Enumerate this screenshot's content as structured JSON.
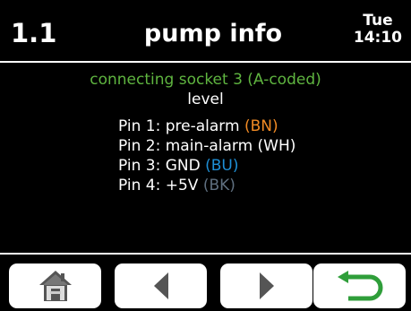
{
  "header": {
    "menu_number": "1.1",
    "title": "pump info",
    "day": "Tue",
    "time": "14:10"
  },
  "content": {
    "subtitle": "connecting socket 3 (A-coded)",
    "subheading": "level",
    "pins": [
      {
        "label": "Pin 1: pre-alarm",
        "code": "(BN)",
        "code_color": "#f08a24"
      },
      {
        "label": "Pin 2: main-alarm (WH)",
        "code": "",
        "code_color": "#ffffff"
      },
      {
        "label": "Pin 3: GND",
        "code": "(BU)",
        "code_color": "#1e8fd6"
      },
      {
        "label": "Pin 4: +5V",
        "code": "(BK)",
        "code_color": "#5f6f7f"
      }
    ]
  },
  "softkeys": [
    {
      "icon": "home-icon"
    },
    {
      "icon": "arrow-left-icon"
    },
    {
      "icon": "arrow-right-icon"
    },
    {
      "icon": "return-arrow-icon"
    }
  ],
  "colors": {
    "background": "#000000",
    "text": "#ffffff",
    "subtitle_green": "#5fb540",
    "return_icon_green": "#2f9e3a",
    "icon_grey": "#555555"
  }
}
